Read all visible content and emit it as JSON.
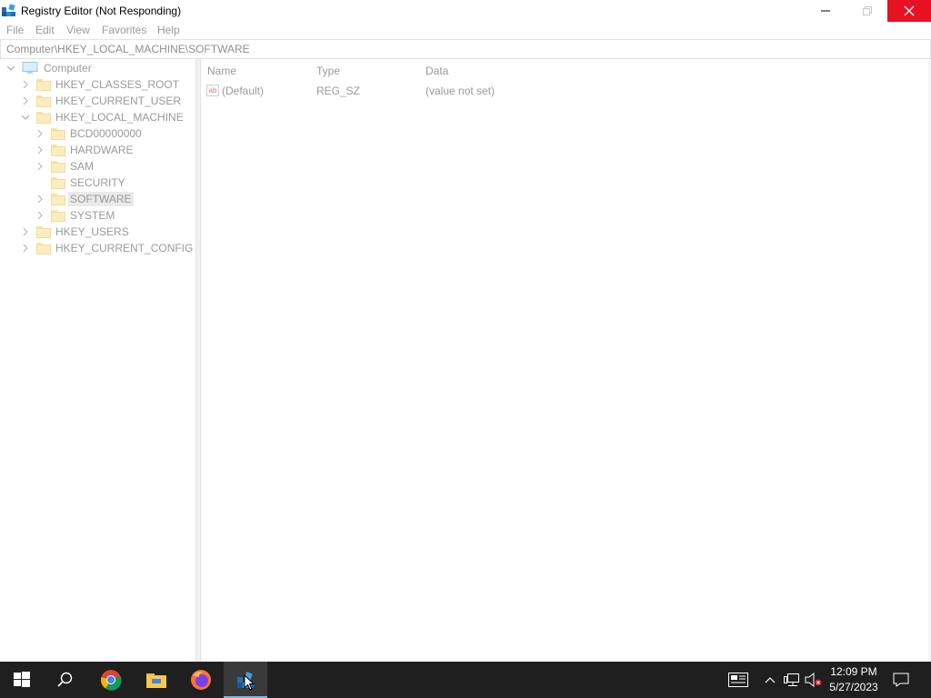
{
  "window": {
    "title": "Registry Editor (Not Responding)"
  },
  "menu": {
    "items": [
      "File",
      "Edit",
      "View",
      "Favorites",
      "Help"
    ]
  },
  "address": {
    "path": "Computer\\HKEY_LOCAL_MACHINE\\SOFTWARE"
  },
  "tree": {
    "root": "Computer",
    "hives": [
      "HKEY_CLASSES_ROOT",
      "HKEY_CURRENT_USER",
      "HKEY_LOCAL_MACHINE",
      "HKEY_USERS",
      "HKEY_CURRENT_CONFIG"
    ],
    "hklm_children": [
      "BCD00000000",
      "HARDWARE",
      "SAM",
      "SECURITY",
      "SOFTWARE",
      "SYSTEM"
    ],
    "selected": "SOFTWARE"
  },
  "list": {
    "headers": [
      "Name",
      "Type",
      "Data"
    ],
    "rows": [
      {
        "name": "(Default)",
        "type": "REG_SZ",
        "data": "(value not set)",
        "icon": "string-value-icon"
      }
    ]
  },
  "taskbar": {
    "apps": [
      "start-icon",
      "search-icon",
      "chrome-icon",
      "file-explorer-icon",
      "firefox-icon",
      "regedit-icon"
    ],
    "active_app": "regedit-icon",
    "time": "12:09 PM",
    "date": "5/27/2023"
  },
  "colors": {
    "close_button": "#e81123",
    "taskbar": "#1f1f1f",
    "active_indicator": "#76b9ed",
    "dimmed_text": "#9a9a9a"
  }
}
